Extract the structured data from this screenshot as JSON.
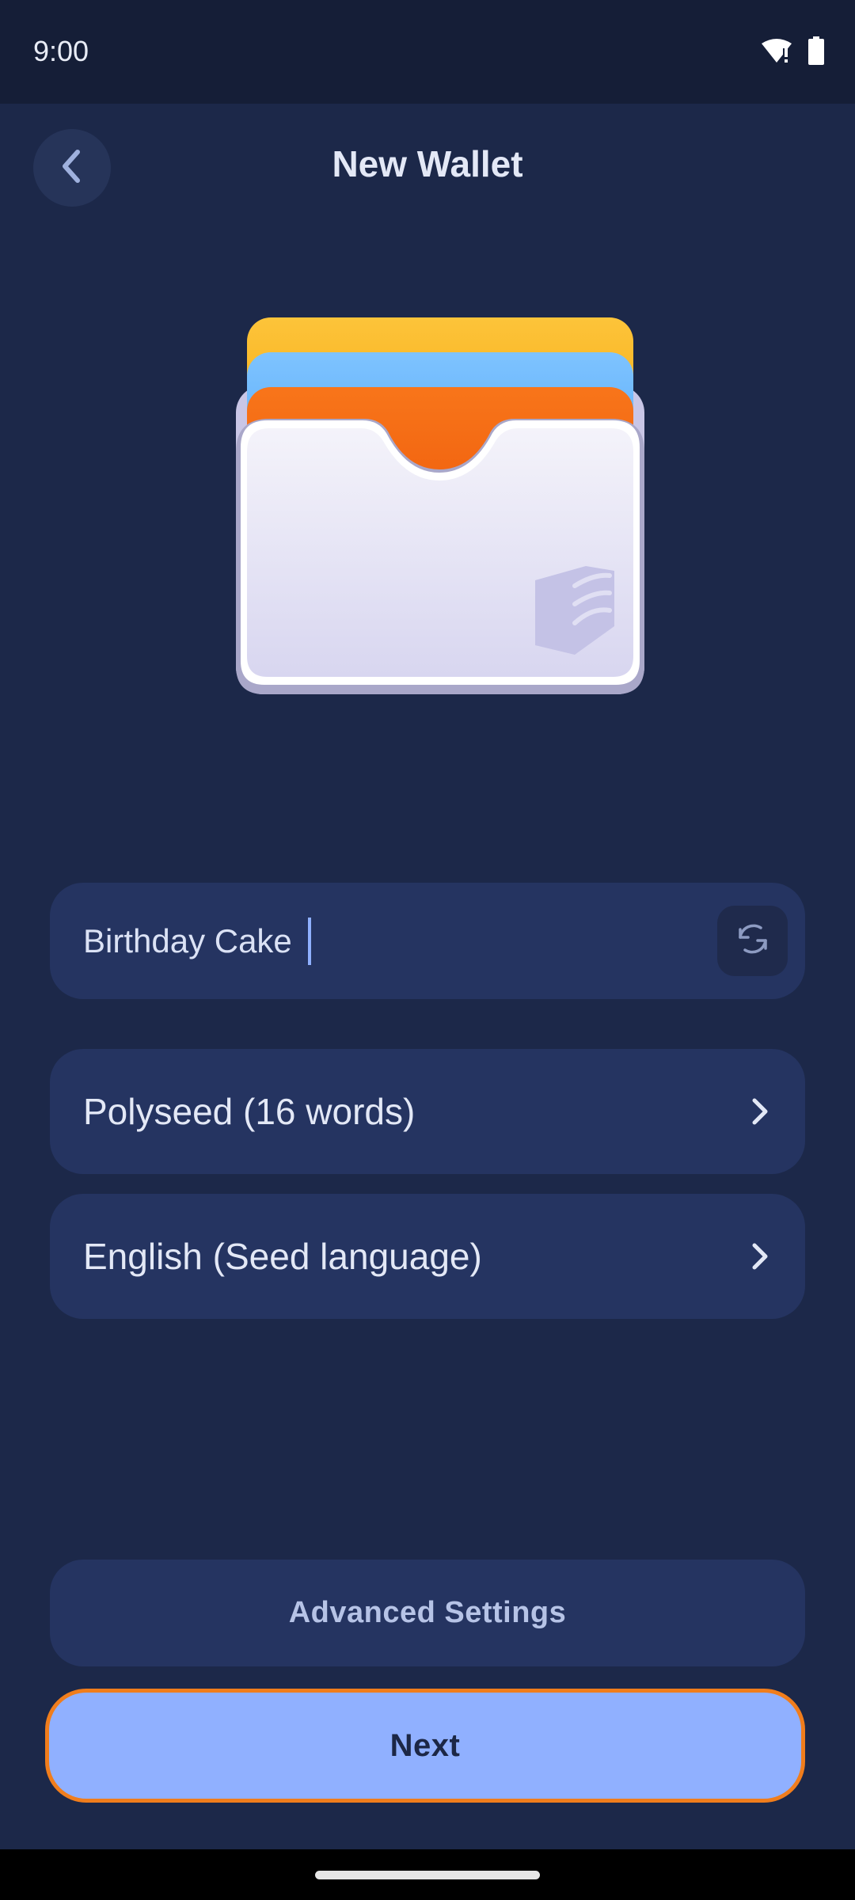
{
  "status_bar": {
    "time": "9:00",
    "icons": [
      "wifi-alert-icon",
      "battery-icon"
    ]
  },
  "header": {
    "title": "New Wallet",
    "back_icon": "chevron-left-icon"
  },
  "illustration": {
    "name": "wallet-cards-illustration",
    "colors": {
      "card_back": "#fbb019",
      "card_middle": "#63b3fb",
      "card_front": "#f26a10",
      "pocket": "#ececf6"
    }
  },
  "wallet_name": {
    "value": "Birthday Cake",
    "refresh_icon": "refresh-icon"
  },
  "seed_type": {
    "label": "Polyseed (16 words)",
    "icon": "chevron-right-icon"
  },
  "seed_language": {
    "label": "English (Seed language)",
    "icon": "chevron-right-icon"
  },
  "advanced_settings": {
    "label": "Advanced Settings"
  },
  "next": {
    "label": "Next"
  },
  "colors": {
    "background": "#1c2849",
    "surface": "#253461",
    "accent": "#90b0ff",
    "focus_ring": "#f07d1c"
  }
}
